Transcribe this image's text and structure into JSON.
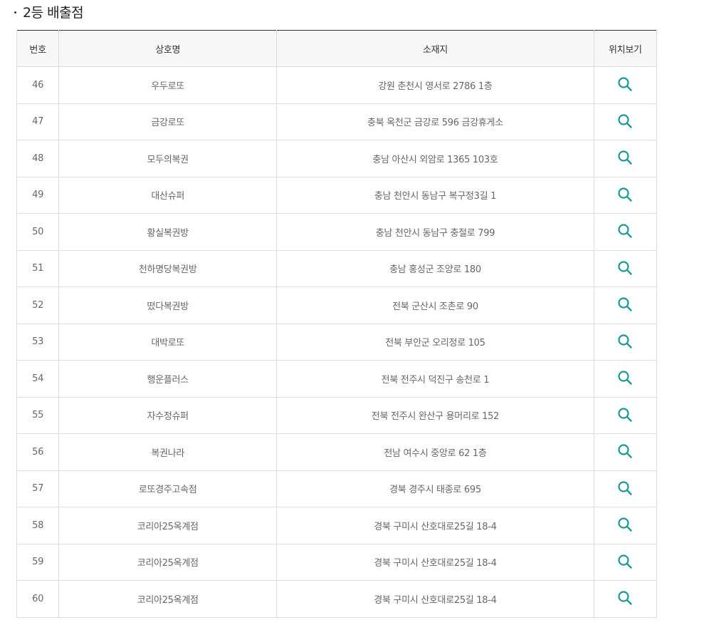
{
  "section": {
    "title": "2등 배출점"
  },
  "colors": {
    "icon_accent": "#1a9a94",
    "header_bg": "#f7f7f7",
    "border": "#dddddd",
    "top_border": "#333333"
  },
  "table": {
    "headers": {
      "number": "번호",
      "store_name": "상호명",
      "address": "소재지",
      "view_location": "위치보기"
    },
    "rows": [
      {
        "number": "46",
        "store_name": "우두로또",
        "address": "강원 춘천시 영서로 2786 1층",
        "icon": "search-icon"
      },
      {
        "number": "47",
        "store_name": "금강로또",
        "address": "충북 옥천군 금강로 596 금강휴게소",
        "icon": "search-icon"
      },
      {
        "number": "48",
        "store_name": "모두의복권",
        "address": "충남 아산시 외암로 1365 103호",
        "icon": "search-icon"
      },
      {
        "number": "49",
        "store_name": "대산슈퍼",
        "address": "충남 천안시 동남구 복구정3길 1",
        "icon": "search-icon"
      },
      {
        "number": "50",
        "store_name": "황실복권방",
        "address": "충남 천안시 동남구 충절로 799",
        "icon": "search-icon"
      },
      {
        "number": "51",
        "store_name": "천하명당복권방",
        "address": "충남 홍성군 조양로 180",
        "icon": "search-icon"
      },
      {
        "number": "52",
        "store_name": "떴다복권방",
        "address": "전북 군산시 조촌로 90",
        "icon": "search-icon"
      },
      {
        "number": "53",
        "store_name": "대박로또",
        "address": "전북 부안군 오리정로 105",
        "icon": "search-icon"
      },
      {
        "number": "54",
        "store_name": "행운플러스",
        "address": "전북 전주시 덕진구 송천로 1",
        "icon": "search-icon"
      },
      {
        "number": "55",
        "store_name": "자수정슈퍼",
        "address": "전북 전주시 완산구 용머리로 152",
        "icon": "search-icon"
      },
      {
        "number": "56",
        "store_name": "복권나라",
        "address": "전남 여수시 중앙로 62 1층",
        "icon": "search-icon"
      },
      {
        "number": "57",
        "store_name": "로또경주고속점",
        "address": "경북 경주시 태종로 695",
        "icon": "search-icon"
      },
      {
        "number": "58",
        "store_name": "코리아25옥계점",
        "address": "경북 구미시 산호대로25길 18-4",
        "icon": "search-icon"
      },
      {
        "number": "59",
        "store_name": "코리아25옥계점",
        "address": "경북 구미시 산호대로25길 18-4",
        "icon": "search-icon"
      },
      {
        "number": "60",
        "store_name": "코리아25옥계점",
        "address": "경북 구미시 산호대로25길 18-4",
        "icon": "search-icon"
      }
    ]
  }
}
